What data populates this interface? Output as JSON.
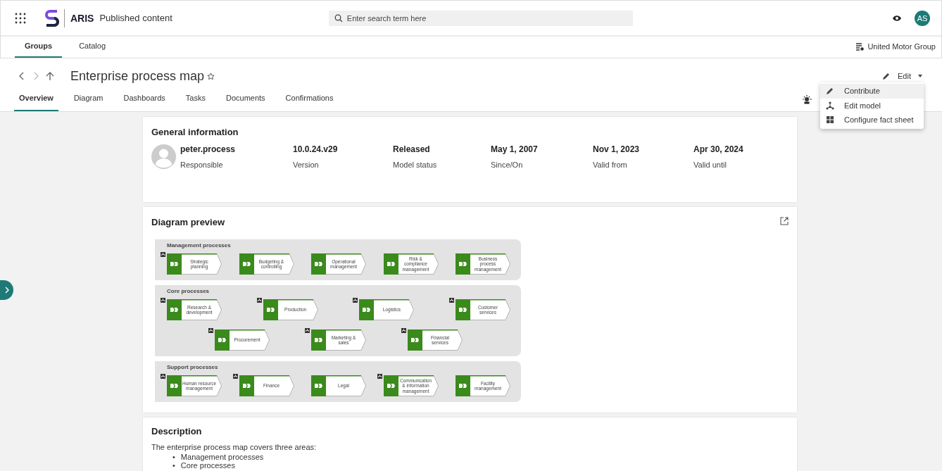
{
  "header": {
    "app_name": "ARIS",
    "section": "Published content",
    "search": {
      "placeholder": "Enter search term here"
    },
    "avatar": "AS"
  },
  "nav_tabs": [
    {
      "label": "Groups",
      "selected": true
    },
    {
      "label": "Catalog",
      "selected": false
    }
  ],
  "database": "United Motor Group",
  "page": {
    "title": "Enterprise process map",
    "favorite": false,
    "edit_button": "Edit",
    "tabs": [
      {
        "label": "Overview",
        "selected": true
      },
      {
        "label": "Diagram",
        "selected": false
      },
      {
        "label": "Dashboards",
        "selected": false
      },
      {
        "label": "Tasks",
        "selected": false
      },
      {
        "label": "Documents",
        "selected": false
      },
      {
        "label": "Confirmations",
        "selected": false
      }
    ]
  },
  "edit_menu": [
    {
      "label": "Contribute",
      "kind": "pencil",
      "selected": true
    },
    {
      "label": "Edit model",
      "kind": "model",
      "selected": false
    },
    {
      "label": "Configure fact sheet",
      "kind": "grid",
      "selected": false
    }
  ],
  "general_information": {
    "title": "General information",
    "fields": [
      {
        "value": "peter.process",
        "label": "Responsible"
      },
      {
        "value": "10.0.24.v29",
        "label": "Version"
      },
      {
        "value": "Released",
        "label": "Model status"
      },
      {
        "value": "May 1, 2007",
        "label": "Since/On"
      },
      {
        "value": "Nov 1, 2023",
        "label": "Valid from"
      },
      {
        "value": "Apr 30, 2024",
        "label": "Valid until"
      }
    ]
  },
  "diagram_preview": {
    "title": "Diagram preview",
    "lanes": [
      {
        "title": "Management processes",
        "rows": [
          [
            {
              "label": "Strategic planning",
              "assigned": true
            },
            {
              "label": "Budgeting & controlling",
              "assigned": false
            },
            {
              "label": "Operational management",
              "assigned": false
            },
            {
              "label": "Risk & compliance management",
              "assigned": false
            },
            {
              "label": "Business process management",
              "assigned": false
            }
          ]
        ]
      },
      {
        "title": "Core processes",
        "rows": [
          [
            {
              "label": "Research & development",
              "assigned": true
            },
            {
              "label": "Production",
              "assigned": true
            },
            {
              "label": "Logistics",
              "assigned": true
            },
            {
              "label": "Customer services",
              "assigned": true
            }
          ],
          [
            {
              "label": "Procurement",
              "assigned": true
            },
            {
              "label": "Marketing & sales",
              "assigned": true
            },
            {
              "label": "Financial services",
              "assigned": true
            }
          ]
        ]
      },
      {
        "title": "Support processes",
        "rows": [
          [
            {
              "label": "Human resource management",
              "assigned": true
            },
            {
              "label": "Finance",
              "assigned": true
            },
            {
              "label": "Legal",
              "assigned": false
            },
            {
              "label": "Communication & information management",
              "assigned": true
            },
            {
              "label": "Facility management",
              "assigned": false
            }
          ]
        ]
      }
    ]
  },
  "description": {
    "title": "Description",
    "intro": "The enterprise process map covers three areas:",
    "bullets": [
      {
        "marker": "•",
        "text": "Management processes"
      },
      {
        "marker": "•",
        "text": "Core processes"
      }
    ]
  }
}
